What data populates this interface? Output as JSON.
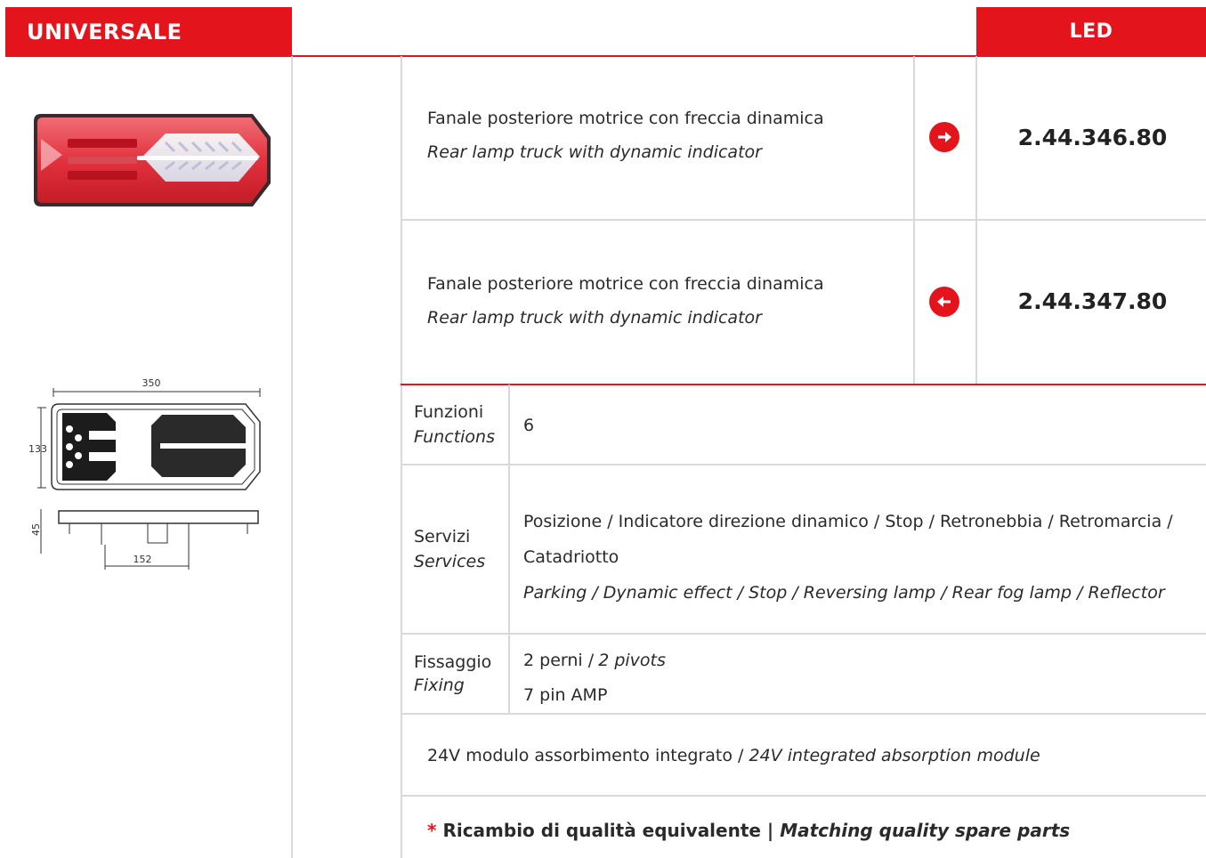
{
  "header": {
    "category": "UNIVERSALE",
    "technology": "LED"
  },
  "colors": {
    "accent": "#e3141b",
    "divider": "#d9d9d9"
  },
  "products": [
    {
      "description_it": "Fanale posteriore motrice con freccia dinamica",
      "description_en": "Rear lamp truck with dynamic indicator",
      "direction_icon": "arrow-right-icon",
      "code": "2.44.346.80"
    },
    {
      "description_it": "Fanale posteriore motrice con freccia dinamica",
      "description_en": "Rear lamp truck with dynamic indicator",
      "direction_icon": "arrow-left-icon",
      "code": "2.44.347.80"
    }
  ],
  "drawing": {
    "width_label": "350",
    "height_label": "133",
    "depth_label": "45",
    "pin_spacing_label": "152"
  },
  "specs": {
    "functions": {
      "label_it": "Funzioni",
      "label_en": "Functions",
      "value": "6"
    },
    "services": {
      "label_it": "Servizi",
      "label_en": "Services",
      "value_it_line1": "Posizione / Indicatore direzione dinamico / Stop / Retronebbia / Retromarcia /",
      "value_it_line2": "Catadriotto",
      "value_en": "Parking / Dynamic effect / Stop / Reversing lamp / Rear fog lamp / Reflector"
    },
    "fixing": {
      "label_it": "Fissaggio",
      "label_en": "Fixing",
      "value_line1_it": "2 perni /",
      "value_line1_en": "2 pivots",
      "value_line2": "7 pin AMP"
    }
  },
  "note": {
    "it": "24V modulo assorbimento integrato / ",
    "en": "24V integrated absorption module"
  },
  "footer": {
    "star": "*",
    "it": "Ricambio di qualità equivalente | ",
    "en": "Matching quality spare parts"
  }
}
